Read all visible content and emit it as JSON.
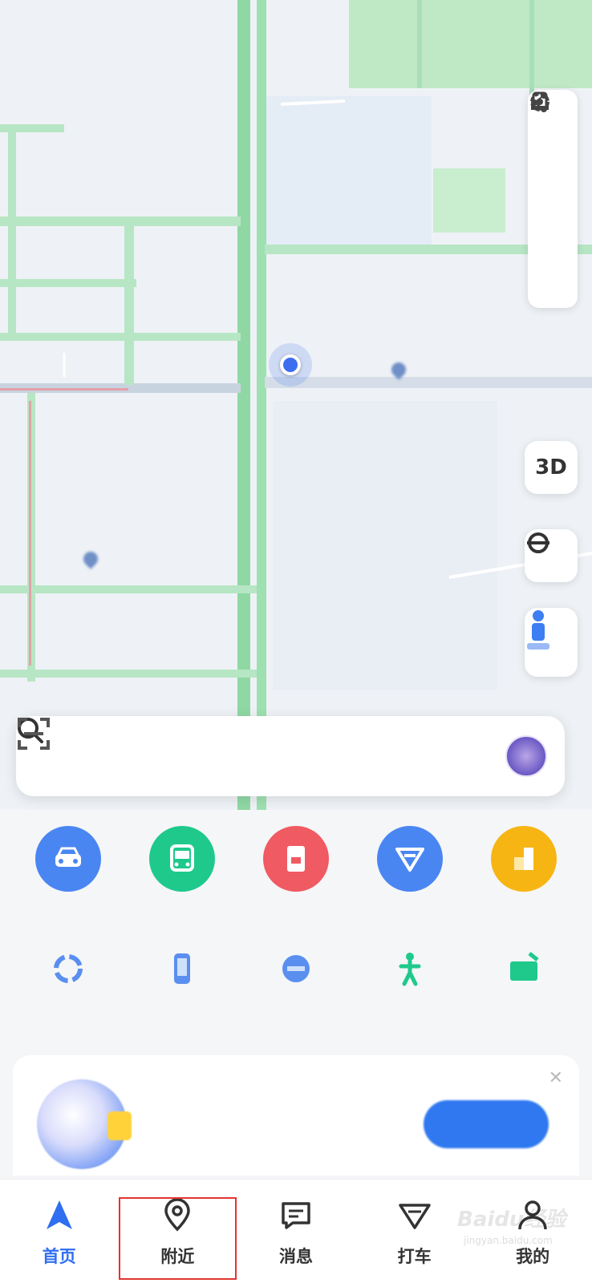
{
  "map": {
    "labels": [
      "",
      "",
      "",
      "",
      "",
      "",
      "",
      "",
      "",
      ""
    ],
    "controls": {
      "layers_label": "",
      "settings_label": "",
      "share_label": "",
      "three_d": "3D"
    }
  },
  "search": {
    "placeholder": ""
  },
  "quick_actions": [
    {
      "label": "",
      "icon": "car-icon",
      "color": "#4a86f2"
    },
    {
      "label": "",
      "icon": "bus-icon",
      "color": "#1fc98c"
    },
    {
      "label": "",
      "icon": "ticket-icon",
      "color": "#f05a62"
    },
    {
      "label": "",
      "icon": "taxi-icon",
      "color": "#4a86f2"
    },
    {
      "label": "",
      "icon": "building-icon",
      "color": "#f7b514"
    }
  ],
  "small_actions": [
    {
      "label": "",
      "icon": "refuel-icon"
    },
    {
      "label": "",
      "icon": "phone-icon"
    },
    {
      "label": "",
      "icon": "food-icon"
    },
    {
      "label": "",
      "icon": "walk-icon"
    },
    {
      "label": "",
      "icon": "hotel-icon"
    }
  ],
  "promo": {
    "title": "",
    "subtitle": "",
    "cta": ""
  },
  "tabbar": [
    {
      "label": "首页",
      "icon": "navigation-arrow-icon",
      "active": true
    },
    {
      "label": "附近",
      "icon": "location-pin-icon",
      "active": false
    },
    {
      "label": "消息",
      "icon": "message-icon",
      "active": false
    },
    {
      "label": "打车",
      "icon": "taxi-ticket-icon",
      "active": false
    },
    {
      "label": "我的",
      "icon": "profile-icon",
      "active": false
    }
  ],
  "watermark": {
    "text": "Baidu经验",
    "url": "jingyan.baidu.com"
  }
}
